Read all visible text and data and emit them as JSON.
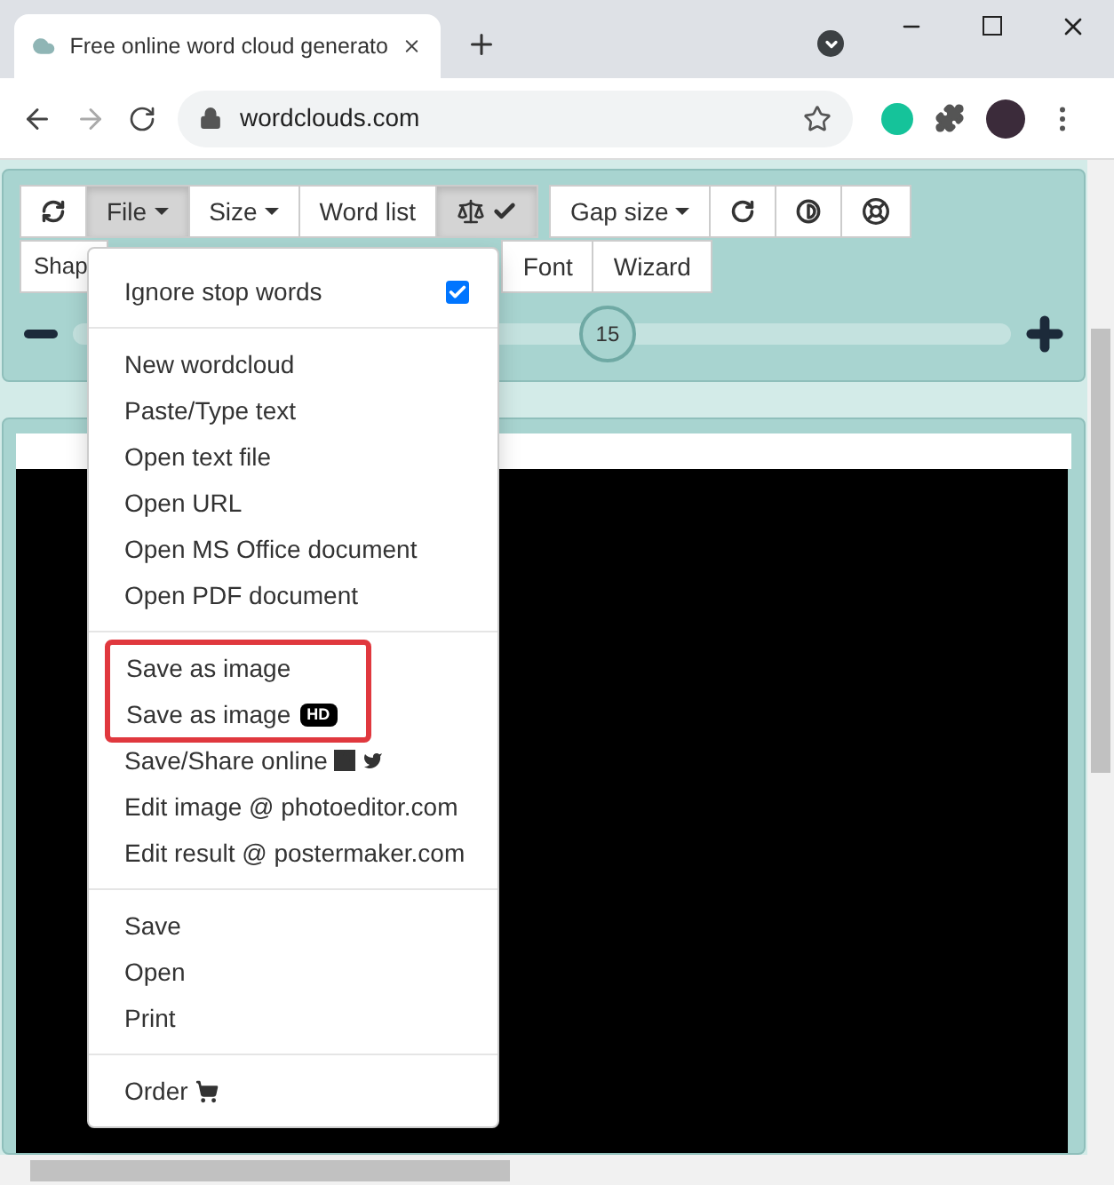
{
  "browser": {
    "tab_title": "Free online word cloud generato",
    "address": "wordclouds.com"
  },
  "toolbar": {
    "row_1": [
      {
        "kind": "icon",
        "pressed": false
      },
      {
        "kind": "menu",
        "label": "File",
        "pressed": true
      },
      {
        "kind": "menu",
        "label": "Size",
        "pressed": false
      },
      {
        "kind": "text",
        "label": "Word list",
        "pressed": false
      },
      {
        "kind": "icon",
        "pressed": true
      }
    ],
    "row_1b": [
      {
        "kind": "menu",
        "label": "Gap size",
        "pressed": false
      },
      {
        "kind": "icon",
        "pressed": false
      },
      {
        "kind": "icon",
        "pressed": false
      },
      {
        "kind": "icon",
        "pressed": false
      }
    ],
    "row_2": [
      {
        "kind": "text",
        "label": "Shap",
        "pressed": false
      },
      {
        "kind": "text",
        "label": "Font",
        "pressed": false
      },
      {
        "kind": "text",
        "label": "Wizard",
        "pressed": false
      }
    ],
    "slider": {
      "value": "15",
      "level": 0.57
    }
  },
  "file_menu": {
    "sections": [
      [
        {
          "kind": "check",
          "label": "Ignore stop words",
          "checked": true,
          "highlighted": false
        }
      ],
      [
        {
          "kind": "item",
          "label": "New wordcloud",
          "highlighted": false
        },
        {
          "kind": "item",
          "label": "Paste/Type text",
          "highlighted": false
        },
        {
          "kind": "item",
          "label": "Open text file",
          "highlighted": false
        },
        {
          "kind": "item",
          "label": "Open URL",
          "highlighted": false
        },
        {
          "kind": "item",
          "label": "Open MS Office document",
          "highlighted": false
        },
        {
          "kind": "item",
          "label": "Open PDF document",
          "highlighted": false
        }
      ],
      [
        {
          "kind": "item",
          "label": "Save as image",
          "highlighted": true
        },
        {
          "kind": "badge",
          "label": "Save as image",
          "badge": "HD",
          "highlighted": true
        },
        {
          "kind": "social",
          "label": "Save/Share online",
          "highlighted": false
        },
        {
          "kind": "item",
          "label": "Edit image @ photoeditor.com",
          "highlighted": false
        },
        {
          "kind": "item",
          "label": "Edit result @ postermaker.com",
          "highlighted": false
        }
      ],
      [
        {
          "kind": "item",
          "label": "Save",
          "highlighted": false
        },
        {
          "kind": "item",
          "label": "Open",
          "highlighted": false
        },
        {
          "kind": "item",
          "label": "Print",
          "highlighted": false
        }
      ],
      [
        {
          "kind": "cart",
          "label": "Order",
          "highlighted": false
        }
      ]
    ]
  }
}
